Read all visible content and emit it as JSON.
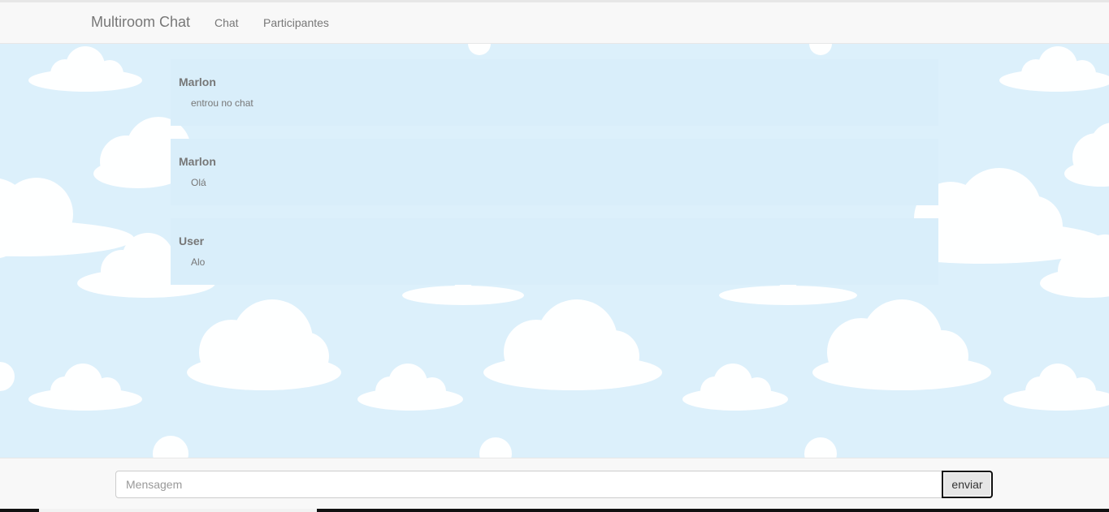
{
  "navbar": {
    "brand": "Multiroom Chat",
    "links": [
      {
        "label": "Chat"
      },
      {
        "label": "Participantes"
      }
    ]
  },
  "messages": [
    {
      "author": "Marlon",
      "text": "entrou no chat"
    },
    {
      "author": "Marlon",
      "text": "Olá"
    },
    {
      "author": "User",
      "text": "Alo"
    }
  ],
  "composer": {
    "placeholder": "Mensagem",
    "value": "",
    "send_label": "enviar"
  },
  "colors": {
    "sky_background": "#dcf0fb",
    "message_background": "#d9eefa",
    "navbar_background": "#f8f8f8",
    "text_muted": "#777777"
  }
}
